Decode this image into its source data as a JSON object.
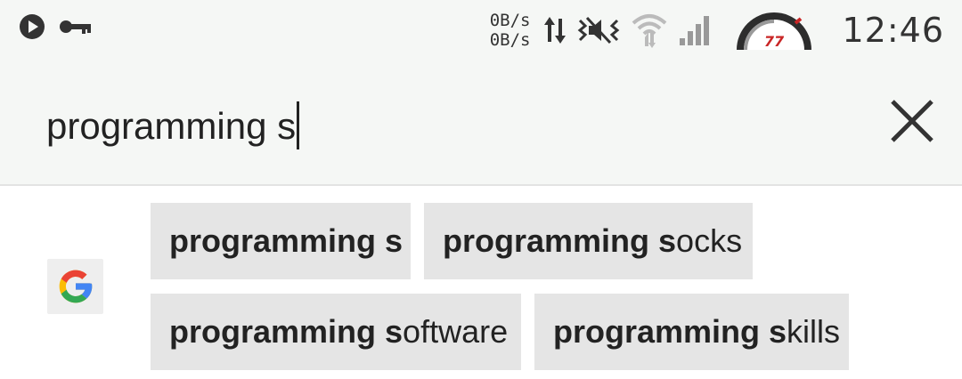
{
  "status_bar": {
    "left_icons": [
      "play-icon",
      "key-icon"
    ],
    "net_up": "0B/s",
    "net_down": "0B/s",
    "speed_meter_label": "77",
    "time": "12:46"
  },
  "search": {
    "query": "programming s",
    "clear_icon": "close-icon"
  },
  "suggestions": {
    "provider_icon": "google-g-icon",
    "items": [
      {
        "bold": "programming s",
        "rest": ""
      },
      {
        "bold": "programming s",
        "rest": "ocks"
      },
      {
        "bold": "programming s",
        "rest": "oftware"
      },
      {
        "bold": "programming s",
        "rest": "kills"
      }
    ]
  },
  "colors": {
    "bar_background": "#f5f7f5",
    "chip_background": "#e5e5e5",
    "google_blue": "#4285F4",
    "google_red": "#EA4335",
    "google_yellow": "#FBBC05",
    "google_green": "#34A853"
  }
}
